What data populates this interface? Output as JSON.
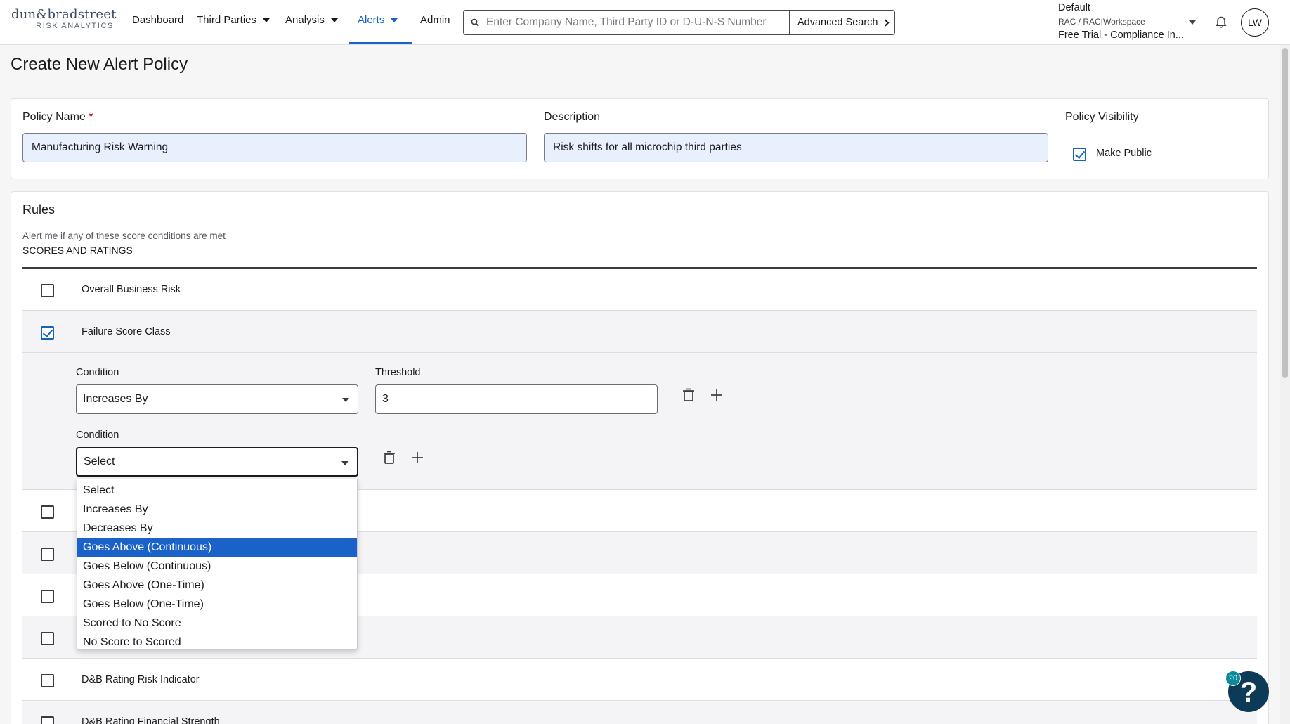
{
  "logo": {
    "name": "dun&bradstreet",
    "sub": "RISK ANALYTICS"
  },
  "nav": {
    "dashboard": "Dashboard",
    "third_parties": "Third Parties",
    "analysis": "Analysis",
    "alerts": "Alerts",
    "admin": "Admin"
  },
  "search": {
    "placeholder": "Enter Company Name, Third Party ID or D-U-N-S Number",
    "advanced_label": "Advanced Search"
  },
  "workspace": {
    "line1": "Default",
    "line2": "RAC / RACIWorkspace",
    "line3": "Free Trial - Compliance In..."
  },
  "user": {
    "initials": "LW"
  },
  "page": {
    "title": "Create New Alert Policy"
  },
  "policy": {
    "name_label": "Policy Name",
    "required_mark": "*",
    "name_value": "Manufacturing Risk Warning",
    "description_label": "Description",
    "description_value": "Risk shifts for all microchip third parties",
    "visibility_label": "Policy Visibility",
    "make_public_label": "Make Public",
    "make_public_checked": true
  },
  "rules": {
    "title": "Rules",
    "subtitle": "Alert me if any of these score conditions are met",
    "section": "SCORES AND RATINGS",
    "items": [
      {
        "label": "Overall Business Risk",
        "checked": false
      },
      {
        "label": "Failure Score Class",
        "checked": true
      },
      {
        "label": "",
        "checked": false
      },
      {
        "label": "",
        "checked": false
      },
      {
        "label": "",
        "checked": false
      },
      {
        "label": "",
        "checked": false
      },
      {
        "label": "D&B Rating Risk Indicator",
        "checked": false
      },
      {
        "label": "D&B Rating Financial Strength",
        "checked": false
      }
    ],
    "conditions": {
      "condition_label": "Condition",
      "threshold_label": "Threshold",
      "first_condition": "Increases By",
      "first_threshold": "3",
      "second_condition": "Select"
    },
    "dropdown_options": [
      "Select",
      "Increases By",
      "Decreases By",
      "Goes Above (Continuous)",
      "Goes Below (Continuous)",
      "Goes Above (One-Time)",
      "Goes Below (One-Time)",
      "Scored to No Score",
      "No Score to Scored"
    ],
    "highlighted_option": "Goes Above (Continuous)"
  },
  "help": {
    "symbol": "?",
    "badge": "20"
  },
  "colors": {
    "accent": "#1a61c8",
    "help_bg": "#0d3a57",
    "badge": "#0a8a9c"
  }
}
